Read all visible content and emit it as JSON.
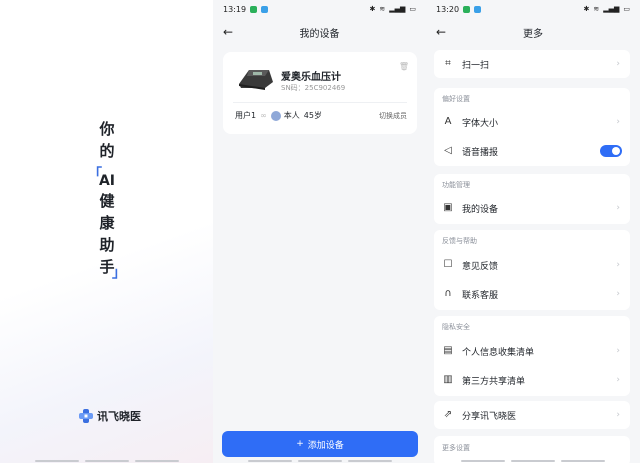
{
  "splash": {
    "chars": [
      "你",
      "的",
      "AI",
      "健",
      "康",
      "助",
      "手"
    ],
    "bracket_open": "「",
    "bracket_close": "」",
    "logo_text": "讯飞晓医"
  },
  "device_screen": {
    "status": {
      "time": "13:19",
      "battery": "5G"
    },
    "back_label": "←",
    "title": "我的设备",
    "device": {
      "name": "爱奥乐血压计",
      "sn": "SN码：25C902469"
    },
    "user": {
      "label": "用户1",
      "member": "本人",
      "age": "45岁",
      "switch": "切换成员"
    },
    "add_button": "添加设备",
    "add_icon": "+"
  },
  "more_screen": {
    "status": {
      "time": "13:20"
    },
    "back_label": "←",
    "title": "更多",
    "scan": "扫一扫",
    "sections": {
      "prefs": "偏好设置",
      "func": "功能管理",
      "feedback": "反馈与帮助",
      "privacy": "隐私安全",
      "more": "更多设置"
    },
    "items": {
      "font_size": "字体大小",
      "voice": "语音播报",
      "my_devices": "我的设备",
      "feedback": "意见反馈",
      "service": "联系客服",
      "personal_info": "个人信息收集清单",
      "third_party": "第三方共享清单",
      "share": "分享讯飞晓医"
    },
    "voice_enabled": true,
    "colors": {
      "accent": "#2f6df6"
    }
  }
}
